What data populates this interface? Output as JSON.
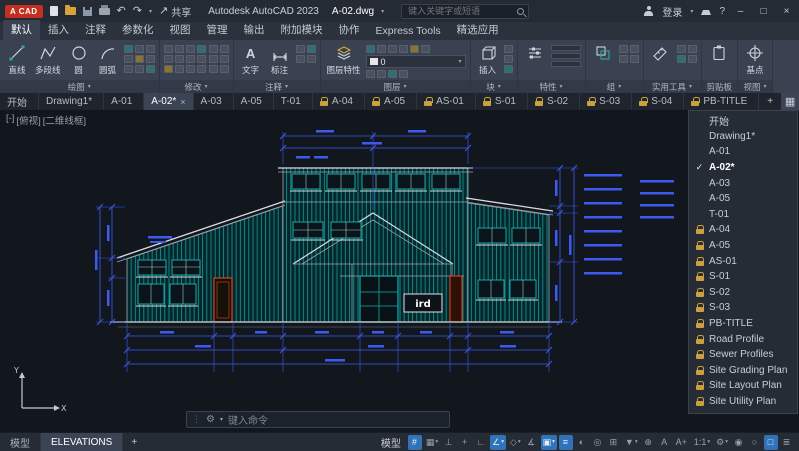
{
  "titlebar": {
    "logo_text": "A CAD",
    "share_label": "共享",
    "app_title": "Autodesk AutoCAD 2023",
    "doc_title": "A-02.dwg",
    "search_placeholder": "键入关键字或短语",
    "signin_label": "登录",
    "help_label": "?",
    "window": {
      "minimize": "–",
      "maximize": "□",
      "close": "×"
    }
  },
  "ribbon": {
    "tabs": [
      {
        "name": "ribbon-tab-default",
        "label": "默认",
        "active": true
      },
      {
        "name": "ribbon-tab-insert",
        "label": "插入"
      },
      {
        "name": "ribbon-tab-annotate",
        "label": "注释"
      },
      {
        "name": "ribbon-tab-parametric",
        "label": "参数化"
      },
      {
        "name": "ribbon-tab-view",
        "label": "视图"
      },
      {
        "name": "ribbon-tab-manage",
        "label": "管理"
      },
      {
        "name": "ribbon-tab-output",
        "label": "输出"
      },
      {
        "name": "ribbon-tab-addins",
        "label": "附加模块"
      },
      {
        "name": "ribbon-tab-collaborate",
        "label": "协作"
      },
      {
        "name": "ribbon-tab-express-tools",
        "label": "Express Tools"
      },
      {
        "name": "ribbon-tab-featured-apps",
        "label": "精选应用"
      }
    ],
    "panels": [
      {
        "label": "绘图"
      },
      {
        "label": "修改"
      },
      {
        "label": "注释"
      },
      {
        "label": "图层"
      },
      {
        "label": "块"
      },
      {
        "label": "特性"
      },
      {
        "label": "组"
      },
      {
        "label": "实用工具"
      },
      {
        "label": "剪贴板"
      },
      {
        "label": "视图"
      }
    ],
    "tools": {
      "line": "直线",
      "polyline": "多段线",
      "circle": "圆",
      "arc": "圆弧",
      "text": "文字",
      "text_icon_glyph": "A",
      "dimension": "标注",
      "layer_properties": "图层特性",
      "layer_current": "0",
      "insert": "插入",
      "base": "基点"
    }
  },
  "filetabs": {
    "new_tab_label": "+",
    "tabs": [
      {
        "name": "file-tab-start",
        "label": "开始"
      },
      {
        "name": "file-tab-drawing1",
        "label": "Drawing1*"
      },
      {
        "name": "file-tab-a-01",
        "label": "A-01"
      },
      {
        "name": "file-tab-a-02",
        "label": "A-02*",
        "active": true,
        "close": "×"
      },
      {
        "name": "file-tab-a-03",
        "label": "A-03"
      },
      {
        "name": "file-tab-a-05",
        "label": "A-05"
      },
      {
        "name": "file-tab-t-01",
        "label": "T-01"
      },
      {
        "name": "file-tab-a-04-locked",
        "label": "A-04",
        "locked": true
      },
      {
        "name": "file-tab-a-05-locked",
        "label": "A-05",
        "locked": true
      },
      {
        "name": "file-tab-as-01",
        "label": "AS-01",
        "locked": true
      },
      {
        "name": "file-tab-s-01",
        "label": "S-01",
        "locked": true
      },
      {
        "name": "file-tab-s-02",
        "label": "S-02",
        "locked": true
      },
      {
        "name": "file-tab-s-03",
        "label": "S-03",
        "locked": true
      },
      {
        "name": "file-tab-s-04",
        "label": "S-04",
        "locked": true
      },
      {
        "name": "file-tab-pb-title",
        "label": "PB-TITLE",
        "locked": true
      }
    ]
  },
  "tab_list": {
    "items": [
      {
        "name": "drawing-item-start",
        "label": "开始"
      },
      {
        "name": "drawing-item-drawing1",
        "label": "Drawing1*"
      },
      {
        "name": "drawing-item-a-01",
        "label": "A-01"
      },
      {
        "name": "drawing-item-a-02",
        "label": "A-02*",
        "checked": true,
        "check": "✓"
      },
      {
        "name": "drawing-item-a-03",
        "label": "A-03"
      },
      {
        "name": "drawing-item-a-05",
        "label": "A-05"
      },
      {
        "name": "drawing-item-t-01",
        "label": "T-01"
      },
      {
        "name": "drawing-item-a-04",
        "label": "A-04",
        "locked": true
      },
      {
        "name": "drawing-item-a-05-locked",
        "label": "A-05",
        "locked": true
      },
      {
        "name": "drawing-item-as-01",
        "label": "AS-01",
        "locked": true
      },
      {
        "name": "drawing-item-s-01",
        "label": "S-01",
        "locked": true
      },
      {
        "name": "drawing-item-s-02",
        "label": "S-02",
        "locked": true
      },
      {
        "name": "drawing-item-s-03",
        "label": "S-03",
        "locked": true
      },
      {
        "name": "drawing-item-pb-title",
        "label": "PB-TITLE",
        "locked": true
      },
      {
        "name": "drawing-item-road-profile",
        "label": "Road Profile",
        "locked": true
      },
      {
        "name": "drawing-item-sewer-profiles",
        "label": "Sewer Profiles",
        "locked": true
      },
      {
        "name": "drawing-item-site-grading-plan",
        "label": "Site Grading Plan",
        "locked": true
      },
      {
        "name": "drawing-item-site-layout-plan",
        "label": "Site Layout Plan",
        "locked": true
      },
      {
        "name": "drawing-item-site-utility-plan",
        "label": "Site Utility Plan",
        "locked": true
      }
    ]
  },
  "canvas": {
    "viewport_controls": [
      "[-]",
      "[俯视]",
      "[二维线框]"
    ],
    "sign_text": "ird",
    "ucs_x": "X",
    "ucs_y": "Y",
    "command_placeholder": "键入命令"
  },
  "statusbar": {
    "layout_tabs": [
      {
        "name": "layout-tab-model",
        "label": "模型"
      },
      {
        "name": "layout-tab-elevations",
        "label": "ELEVATIONS",
        "active": true
      }
    ],
    "new_layout_label": "+",
    "model_toggle_label": "模型",
    "icons": [
      {
        "name": "grid-icon",
        "glyph": "#",
        "active": true
      },
      {
        "name": "snap-icon",
        "glyph": "▦",
        "caret": "▾"
      },
      {
        "name": "infer-constraints-icon",
        "glyph": "⊥"
      },
      {
        "name": "dynamic-input-icon",
        "glyph": "+"
      },
      {
        "name": "ortho-icon",
        "glyph": "∟"
      },
      {
        "name": "polar-tracking-icon",
        "glyph": "∠",
        "caret": "▾",
        "active": true
      },
      {
        "name": "isodraft-icon",
        "glyph": "◇",
        "caret": "▾"
      },
      {
        "name": "object-snap-tracking-icon",
        "glyph": "∡"
      },
      {
        "name": "object-snap-icon",
        "glyph": "▣",
        "caret": "▾",
        "active": true
      },
      {
        "name": "lineweight-icon",
        "glyph": "≡",
        "active": true
      },
      {
        "name": "transparency-icon",
        "glyph": "◐"
      },
      {
        "name": "selection-cycling-icon",
        "glyph": "◎"
      },
      {
        "name": "dynamic-ucs-icon",
        "glyph": "⊞"
      },
      {
        "name": "selection-filter-icon",
        "glyph": "▼",
        "caret": "▾"
      },
      {
        "name": "gizmo-icon",
        "glyph": "⊕"
      },
      {
        "name": "annotation-visibility-icon",
        "glyph": "A"
      },
      {
        "name": "autoscale-icon",
        "glyph": "A+"
      },
      {
        "name": "annotation-scale",
        "glyph": "1:1",
        "caret": "▾"
      },
      {
        "name": "workspace-gear-icon",
        "glyph": "⚙",
        "caret": "▾"
      },
      {
        "name": "annotation-monitor-icon",
        "glyph": "◉"
      },
      {
        "name": "isolate-objects-icon",
        "glyph": "○"
      },
      {
        "name": "clean-screen-icon",
        "glyph": "□",
        "active": true
      },
      {
        "name": "customize-icon",
        "glyph": "≣"
      }
    ]
  },
  "colors": {
    "accent": "#3073b8",
    "dimension_blue": "#3d5af0",
    "hatch_teal": "#158f8f",
    "lock_gold": "#c9a23f",
    "logo_red": "#c3301f"
  }
}
